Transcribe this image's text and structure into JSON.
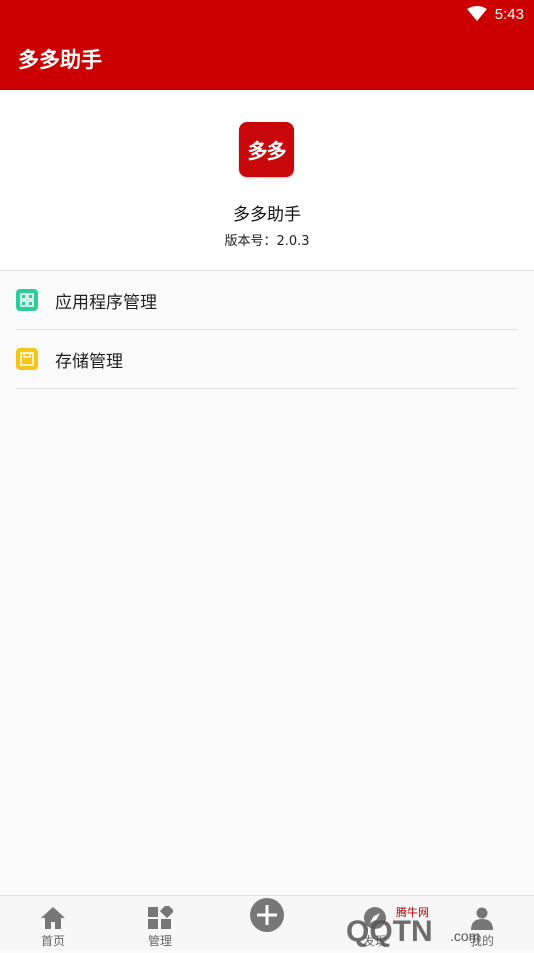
{
  "status_bar": {
    "time": "5:43",
    "wifi_icon": "wifi-icon"
  },
  "app_bar": {
    "title": "多多助手"
  },
  "about": {
    "logo_text": "多多",
    "app_name": "多多助手",
    "version": "版本号：2.0.3"
  },
  "menu": {
    "items": [
      {
        "label": "应用程序管理",
        "icon": "grid-icon",
        "color": "#2ecc9a"
      },
      {
        "label": "存储管理",
        "icon": "storage-icon",
        "color": "#f5c518"
      }
    ]
  },
  "bottom_nav": {
    "items": [
      {
        "label": "首页",
        "icon": "home-icon"
      },
      {
        "label": "管理",
        "icon": "manage-icon"
      },
      {
        "label": "",
        "icon": "add-icon"
      },
      {
        "label": "发现",
        "icon": "discover-icon"
      },
      {
        "label": "我的",
        "icon": "profile-icon"
      }
    ]
  },
  "watermark": {
    "text": "QQTN.com",
    "subtext": "腾牛网"
  },
  "colors": {
    "brand": "#cc0000",
    "background": "#fafafa"
  }
}
